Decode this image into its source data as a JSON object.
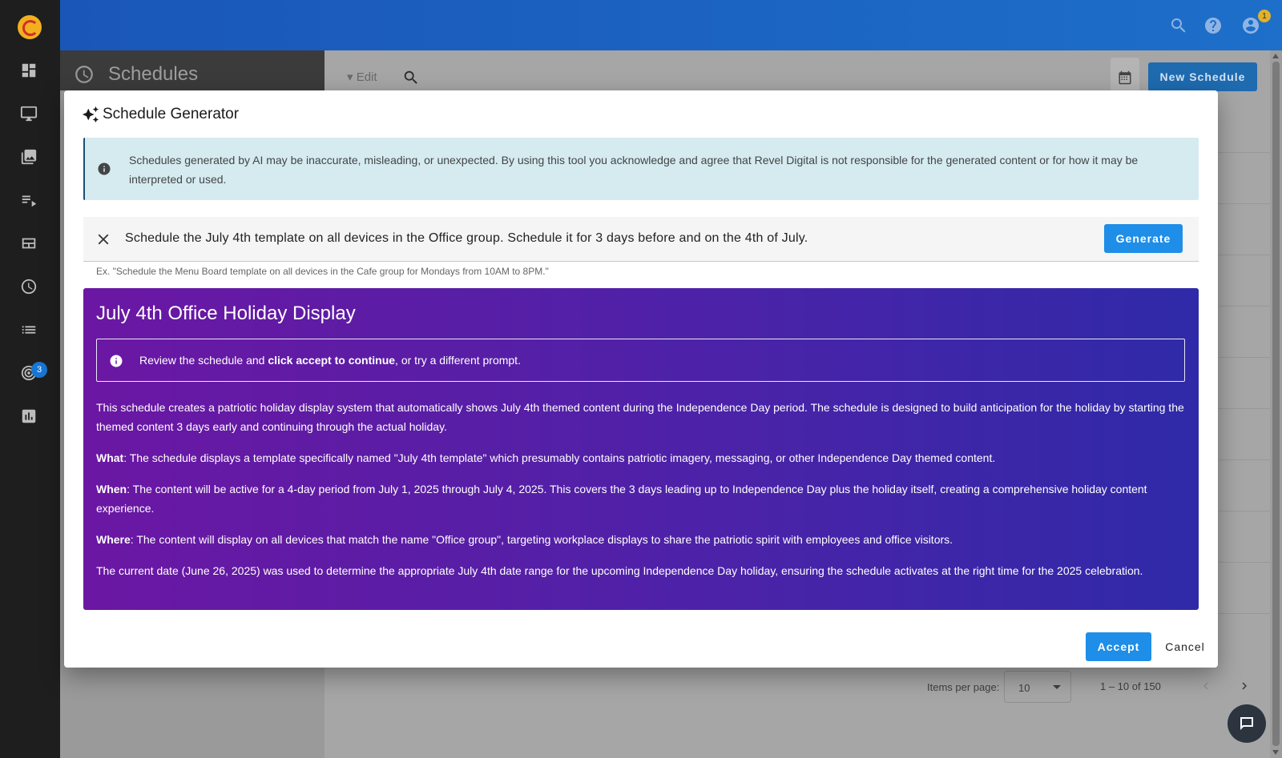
{
  "topbar": {
    "account_badge": "1"
  },
  "sidebar": {
    "badge_count": "3"
  },
  "page": {
    "title": "Schedules",
    "toolbar_edit": "Edit",
    "new_schedule_label": "New Schedule"
  },
  "pager": {
    "items_per_page_label": "Items per page:",
    "items_per_page_value": "10",
    "range": "1 – 10 of 150"
  },
  "modal": {
    "title": "Schedule Generator",
    "disclaimer": "Schedules generated by AI may be inaccurate, misleading, or unexpected. By using this tool you acknowledge and agree that Revel Digital is not responsible for the generated content or for how it may be interpreted or used.",
    "prompt_value": "Schedule the July 4th template on all devices in the Office group. Schedule it for 3 days before and on the 4th of July.",
    "generate_label": "Generate",
    "hint": "Ex. \"Schedule the Menu Board template on all devices in the Cafe group for Mondays from 10AM to 8PM.\"",
    "result": {
      "title": "July 4th Office Holiday Display",
      "review_prefix": "Review the schedule and ",
      "review_bold": "click accept to continue",
      "review_suffix": ", or try a different prompt.",
      "summary": "This schedule creates a patriotic holiday display system that automatically shows July 4th themed content during the Independence Day period. The schedule is designed to build anticipation for the holiday by starting the themed content 3 days early and continuing through the actual holiday.",
      "what_label": "What",
      "what_text": ": The schedule displays a template specifically named \"July 4th template\" which presumably contains patriotic imagery, messaging, or other Independence Day themed content.",
      "when_label": "When",
      "when_text": ": The content will be active for a 4-day period from July 1, 2025 through July 4, 2025. This covers the 3 days leading up to Independence Day plus the holiday itself, creating a comprehensive holiday content experience.",
      "where_label": "Where",
      "where_text": ": The content will display on all devices that match the name \"Office group\", targeting workplace displays to share the patriotic spirit with employees and office visitors.",
      "date_note": "The current date (June 26, 2025) was used to determine the appropriate July 4th date range for the upcoming Independence Day holiday, ensuring the schedule activates at the right time for the 2025 celebration."
    },
    "accept_label": "Accept",
    "cancel_label": "Cancel"
  },
  "colors": {
    "primary": "#1e8ee8",
    "result_gradient_start": "#6b17a3",
    "result_gradient_end": "#2f2aa8",
    "disclaimer_bg": "#d5ebf0"
  }
}
